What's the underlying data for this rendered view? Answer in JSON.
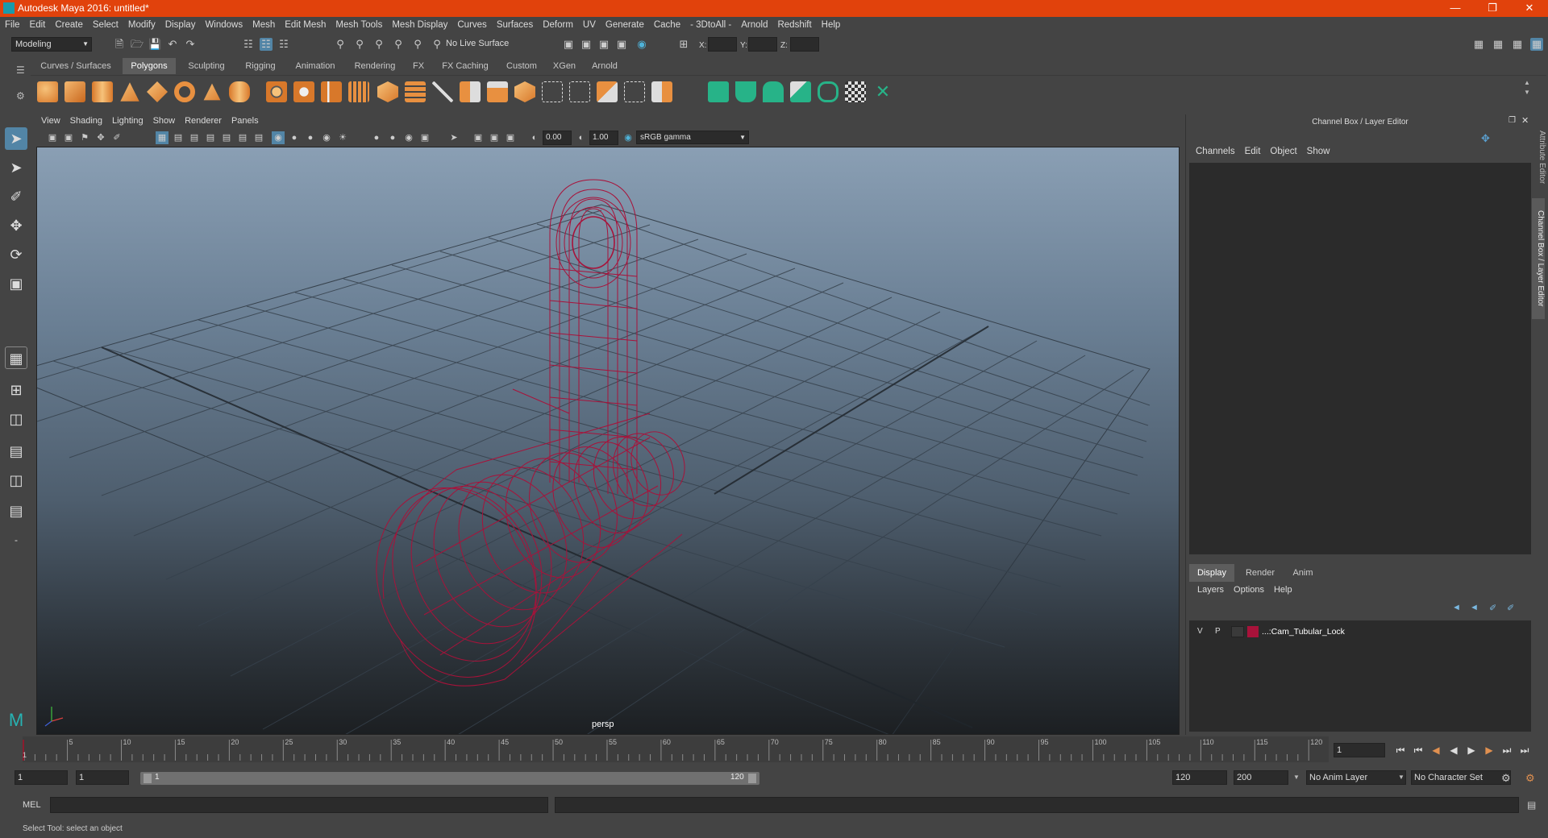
{
  "window": {
    "title": "Autodesk Maya 2016: untitled*"
  },
  "menubar": [
    "File",
    "Edit",
    "Create",
    "Select",
    "Modify",
    "Display",
    "Windows",
    "Mesh",
    "Edit Mesh",
    "Mesh Tools",
    "Mesh Display",
    "Curves",
    "Surfaces",
    "Deform",
    "UV",
    "Generate",
    "Cache",
    "- 3DtoAll -",
    "Arnold",
    "Redshift",
    "Help"
  ],
  "statusline": {
    "mode": "Modeling",
    "live_surface": "No Live Surface",
    "x_label": "X:",
    "y_label": "Y:",
    "z_label": "Z:"
  },
  "shelf": {
    "tabs": [
      "Curves / Surfaces",
      "Polygons",
      "Sculpting",
      "Rigging",
      "Animation",
      "Rendering",
      "FX",
      "FX Caching",
      "Custom",
      "XGen",
      "Arnold"
    ],
    "active_tab": "Polygons"
  },
  "viewport": {
    "menu": [
      "View",
      "Shading",
      "Lighting",
      "Show",
      "Renderer",
      "Panels"
    ],
    "exposure": "0.00",
    "gamma": "1.00",
    "color_space": "sRGB gamma",
    "camera_label": "persp",
    "wire_color": "#a8123a"
  },
  "channel_box": {
    "title": "Channel Box / Layer Editor",
    "menu": [
      "Channels",
      "Edit",
      "Object",
      "Show"
    ],
    "layer_tabs": [
      "Display",
      "Render",
      "Anim"
    ],
    "layer_menu": [
      "Layers",
      "Options",
      "Help"
    ],
    "layer": {
      "v": "V",
      "p": "P",
      "name": "...:Cam_Tubular_Lock",
      "color": "#a8123a"
    },
    "side_tabs": [
      "Attribute Editor",
      "Channel Box / Layer Editor"
    ]
  },
  "timeline": {
    "ticks": [
      "5",
      "10",
      "15",
      "20",
      "25",
      "30",
      "35",
      "40",
      "45",
      "50",
      "55",
      "60",
      "65",
      "70",
      "75",
      "80",
      "85",
      "90",
      "95",
      "100",
      "105",
      "110",
      "115",
      "120"
    ],
    "first_tick": "1",
    "current_frame": "1"
  },
  "range": {
    "start": "1",
    "playback_start": "1",
    "slider_start": "1",
    "slider_end": "120",
    "playback_end": "120",
    "end": "200",
    "anim_layer": "No Anim Layer",
    "character_set": "No Character Set"
  },
  "cmdline": {
    "label": "MEL"
  },
  "helpline": {
    "text": "Select Tool: select an object"
  }
}
